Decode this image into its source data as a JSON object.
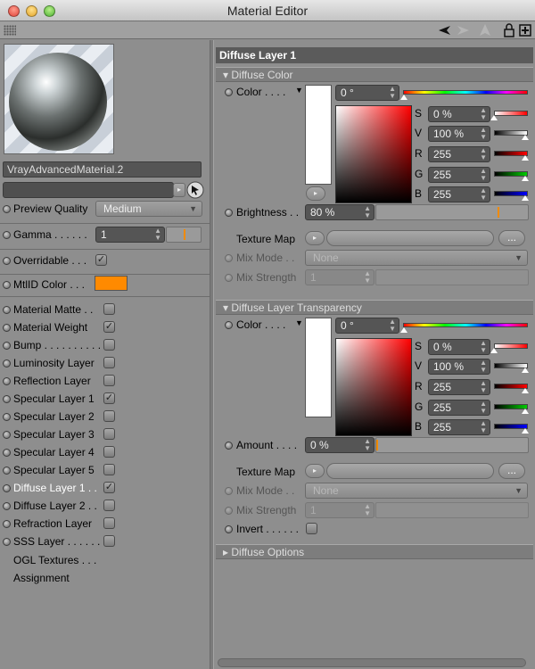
{
  "window": {
    "title": "Material Editor"
  },
  "material": {
    "name": "VrayAdvancedMaterial.2"
  },
  "left": {
    "preview_quality_label": "Preview Quality",
    "preview_quality_value": "Medium",
    "gamma_label": "Gamma",
    "gamma_dots": ". . . . . .",
    "gamma_value": "1",
    "overridable_label": "Overridable . . .",
    "mtlid_label": "MtlID Color . . .",
    "mtlid_color": "#ff8a00",
    "layers": [
      {
        "label": "Material Matte . .",
        "checked": false
      },
      {
        "label": "Material Weight",
        "checked": true
      },
      {
        "label": "Bump . . . . . . . . . .",
        "checked": false
      },
      {
        "label": "Luminosity Layer",
        "checked": false
      },
      {
        "label": "Reflection Layer",
        "checked": false
      },
      {
        "label": "Specular Layer 1",
        "checked": true
      },
      {
        "label": "Specular Layer 2",
        "checked": false
      },
      {
        "label": "Specular Layer 3",
        "checked": false
      },
      {
        "label": "Specular Layer 4",
        "checked": false
      },
      {
        "label": "Specular Layer 5",
        "checked": false
      },
      {
        "label": "Diffuse Layer 1 . .",
        "checked": true,
        "active": true
      },
      {
        "label": "Diffuse Layer 2 . .",
        "checked": false
      },
      {
        "label": "Refraction Layer",
        "checked": false
      },
      {
        "label": "SSS Layer . . . . . . .",
        "checked": false
      }
    ],
    "ogl_label": "OGL Textures . . .",
    "assignment_label": "Assignment"
  },
  "right": {
    "header": "Diffuse Layer 1",
    "diffuse_color": {
      "section": "Diffuse Color",
      "color_label": "Color . . . .",
      "hue": "0 °",
      "S": "0 %",
      "V": "100 %",
      "R": "255",
      "G": "255",
      "B": "255",
      "brightness_label": "Brightness . .",
      "brightness_value": "80 %",
      "brightness_level": 0.8,
      "texture_map_label": "Texture Map",
      "mix_mode_label": "Mix Mode . .",
      "mix_mode_value": "None",
      "mix_strength_label": "Mix Strength",
      "mix_strength_value": "1",
      "ellipsis": "..."
    },
    "transparency": {
      "section": "Diffuse Layer Transparency",
      "color_label": "Color . . . .",
      "hue": "0 °",
      "S": "0 %",
      "V": "100 %",
      "R": "255",
      "G": "255",
      "B": "255",
      "amount_label": "Amount . . . .",
      "amount_value": "0 %",
      "amount_level": 0,
      "texture_map_label": "Texture Map",
      "mix_mode_label": "Mix Mode . .",
      "mix_mode_value": "None",
      "mix_strength_label": "Mix Strength",
      "mix_strength_value": "1",
      "invert_label": "Invert . . . . . .",
      "ellipsis": "..."
    },
    "options_section": "Diffuse Options"
  },
  "channel_letters": {
    "S": "S",
    "V": "V",
    "R": "R",
    "G": "G",
    "B": "B"
  },
  "icons": {
    "check": "✓"
  }
}
